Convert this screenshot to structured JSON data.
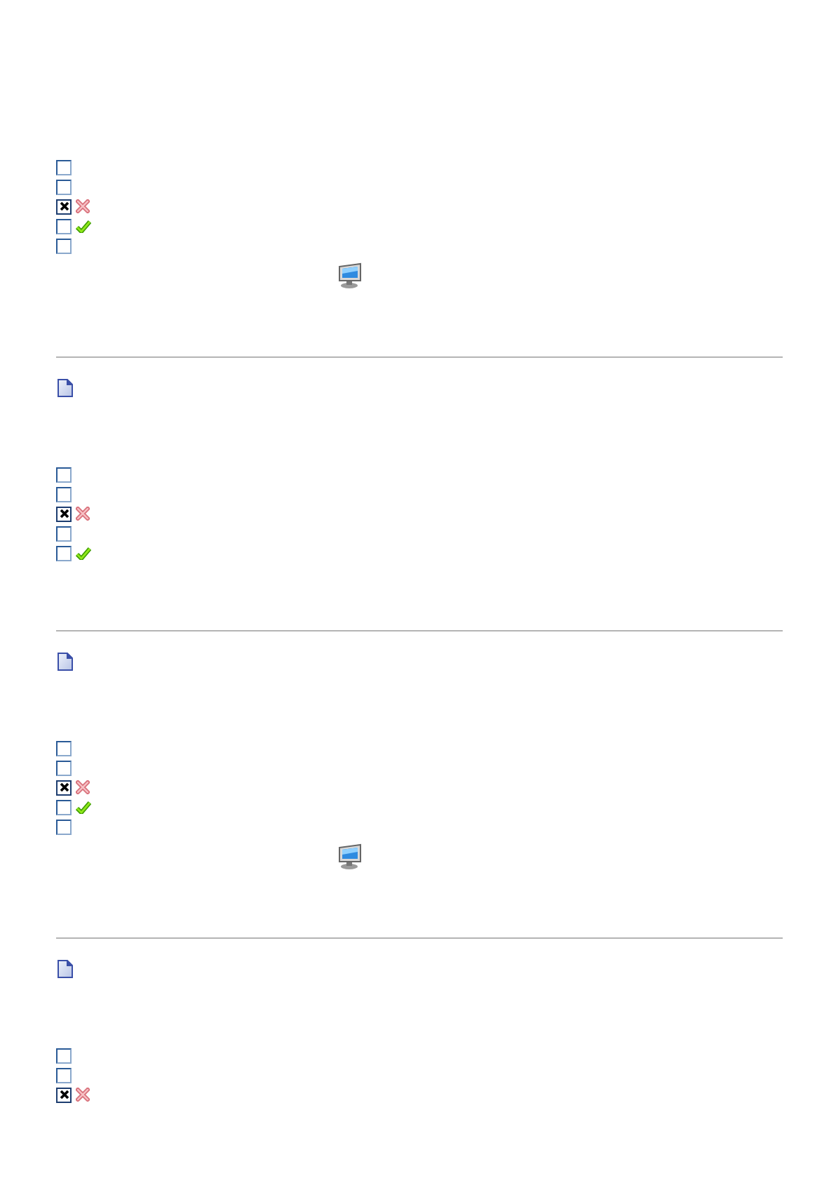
{
  "sections": [
    {
      "document_icon": false,
      "options": [
        {
          "checked": false,
          "wrong": false,
          "correct": false
        },
        {
          "checked": false,
          "wrong": false,
          "correct": false
        },
        {
          "checked": true,
          "wrong": true,
          "correct": false
        },
        {
          "checked": false,
          "wrong": false,
          "correct": true
        },
        {
          "checked": false,
          "wrong": false,
          "correct": false
        }
      ],
      "computer_icon": true
    },
    {
      "document_icon": true,
      "options": [
        {
          "checked": false,
          "wrong": false,
          "correct": false
        },
        {
          "checked": false,
          "wrong": false,
          "correct": false
        },
        {
          "checked": true,
          "wrong": true,
          "correct": false
        },
        {
          "checked": false,
          "wrong": false,
          "correct": false
        },
        {
          "checked": false,
          "wrong": false,
          "correct": true
        }
      ],
      "computer_icon": false
    },
    {
      "document_icon": true,
      "options": [
        {
          "checked": false,
          "wrong": false,
          "correct": false
        },
        {
          "checked": false,
          "wrong": false,
          "correct": false
        },
        {
          "checked": true,
          "wrong": true,
          "correct": false
        },
        {
          "checked": false,
          "wrong": false,
          "correct": true
        },
        {
          "checked": false,
          "wrong": false,
          "correct": false
        }
      ],
      "computer_icon": true
    },
    {
      "document_icon": true,
      "options": [
        {
          "checked": false,
          "wrong": false,
          "correct": false
        },
        {
          "checked": false,
          "wrong": false,
          "correct": false
        },
        {
          "checked": true,
          "wrong": true,
          "correct": false
        }
      ],
      "computer_icon": false
    }
  ]
}
